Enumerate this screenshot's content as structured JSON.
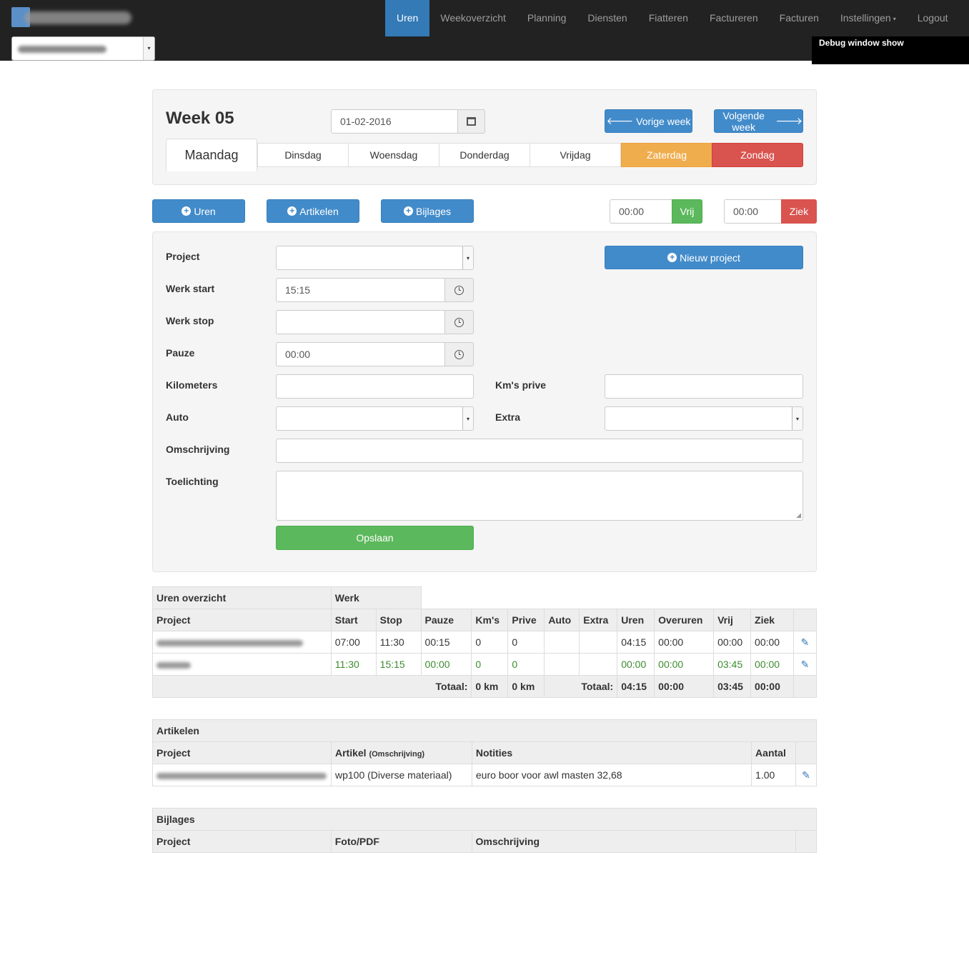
{
  "nav": {
    "items": [
      "Uren",
      "Weekoverzicht",
      "Planning",
      "Diensten",
      "Fiatteren",
      "Factureren",
      "Facturen",
      "Instellingen",
      "Logout"
    ],
    "active_index": 0,
    "dropdown_caret": "▾",
    "debug": "Debug window show"
  },
  "week": {
    "title": "Week 05",
    "date": "01-02-2016",
    "prev_label": "Vorige week",
    "next_label": "Volgende week",
    "days": [
      "Maandag",
      "Dinsdag",
      "Woensdag",
      "Donderdag",
      "Vrijdag",
      "Zaterdag",
      "Zondag"
    ],
    "active_day_index": 0
  },
  "actions": {
    "uren": "Uren",
    "artikelen": "Artikelen",
    "bijlages": "Bijlages",
    "vrij_value": "00:00",
    "vrij_label": "Vrij",
    "ziek_value": "00:00",
    "ziek_label": "Ziek"
  },
  "form": {
    "project_label": "Project",
    "new_project": "Nieuw project",
    "werk_start_label": "Werk start",
    "werk_start_value": "15:15",
    "werk_stop_label": "Werk stop",
    "werk_stop_value": "",
    "pauze_label": "Pauze",
    "pauze_value": "00:00",
    "kilometers_label": "Kilometers",
    "kms_prive_label": "Km's prive",
    "auto_label": "Auto",
    "extra_label": "Extra",
    "omschrijving_label": "Omschrijving",
    "toelichting_label": "Toelichting",
    "save": "Opslaan"
  },
  "uren_table": {
    "title": "Uren overzicht",
    "group": "Werk",
    "headers": [
      "Project",
      "Start",
      "Stop",
      "Pauze",
      "Km's",
      "Prive",
      "Auto",
      "Extra",
      "Uren",
      "Overuren",
      "Vrij",
      "Ziek"
    ],
    "rows": [
      {
        "start": "07:00",
        "stop": "11:30",
        "pauze": "00:15",
        "kms": "0",
        "prive": "0",
        "auto": "",
        "extra": "",
        "uren": "04:15",
        "overuren": "00:00",
        "vrij": "00:00",
        "ziek": "00:00"
      },
      {
        "start": "11:30",
        "stop": "15:15",
        "pauze": "00:00",
        "kms": "0",
        "prive": "0",
        "auto": "",
        "extra": "",
        "uren": "00:00",
        "overuren": "00:00",
        "vrij": "03:45",
        "ziek": "00:00"
      }
    ],
    "totals": {
      "label1": "Totaal:",
      "kms": "0 km",
      "prive": "0 km",
      "label2": "Totaal:",
      "uren": "04:15",
      "overuren": "00:00",
      "vrij": "03:45",
      "ziek": "00:00"
    }
  },
  "artikelen_table": {
    "title": "Artikelen",
    "headers": {
      "project": "Project",
      "artikel": "Artikel",
      "artikel_sub": "(Omschrijving)",
      "notities": "Notities",
      "aantal": "Aantal"
    },
    "rows": [
      {
        "artikel": "wp100 (Diverse materiaal)",
        "notities": "euro boor voor awl masten 32,68",
        "aantal": "1.00"
      }
    ]
  },
  "bijlages_table": {
    "title": "Bijlages",
    "headers": [
      "Project",
      "Foto/PDF",
      "Omschrijving"
    ]
  },
  "icons": {
    "plus": "+",
    "arrow_left": "🡐",
    "arrow_right": "🡒",
    "pencil": "✎",
    "select_caret": "▾"
  },
  "colors": {
    "primary": "#428bca",
    "success": "#5cb85c",
    "warning": "#f0ad4e",
    "danger": "#d9534f",
    "navbar": "#222222"
  }
}
